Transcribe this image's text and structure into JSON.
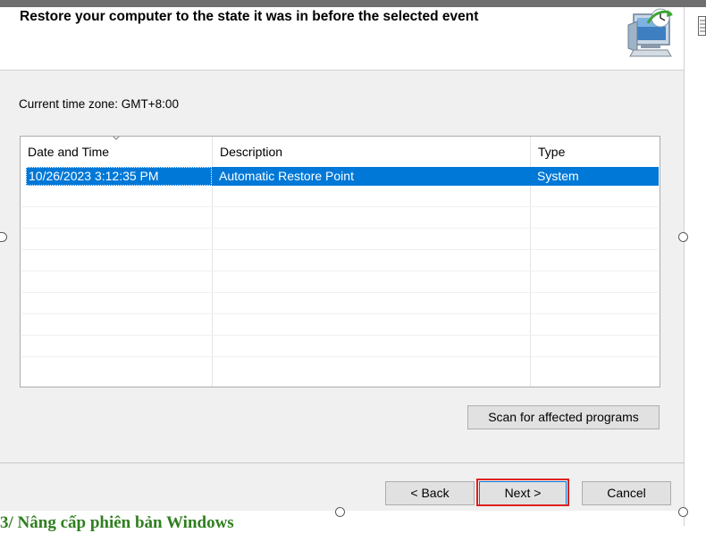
{
  "header": {
    "title": "Restore your computer to the state it was in before the selected event"
  },
  "timezone": {
    "label": "Current time zone: GMT+8:00"
  },
  "table": {
    "columns": [
      "Date and Time",
      "Description",
      "Type"
    ],
    "rows": [
      {
        "date_time": "10/26/2023 3:12:35 PM",
        "description": "Automatic Restore Point",
        "type": "System",
        "selected": true
      }
    ]
  },
  "buttons": {
    "scan": "Scan for affected programs",
    "back": "< Back",
    "next": "Next >",
    "cancel": "Cancel"
  },
  "document": {
    "heading_fragment": "3/ Nâng cấp phiên bản Windows"
  },
  "colors": {
    "selection": "#0078d7",
    "highlight_border": "#e02020",
    "doc_heading": "#2f7f1f"
  },
  "icons": [
    "system-restore-icon",
    "sort-arrow-icon",
    "document-icon",
    "resize-handle-icon"
  ]
}
